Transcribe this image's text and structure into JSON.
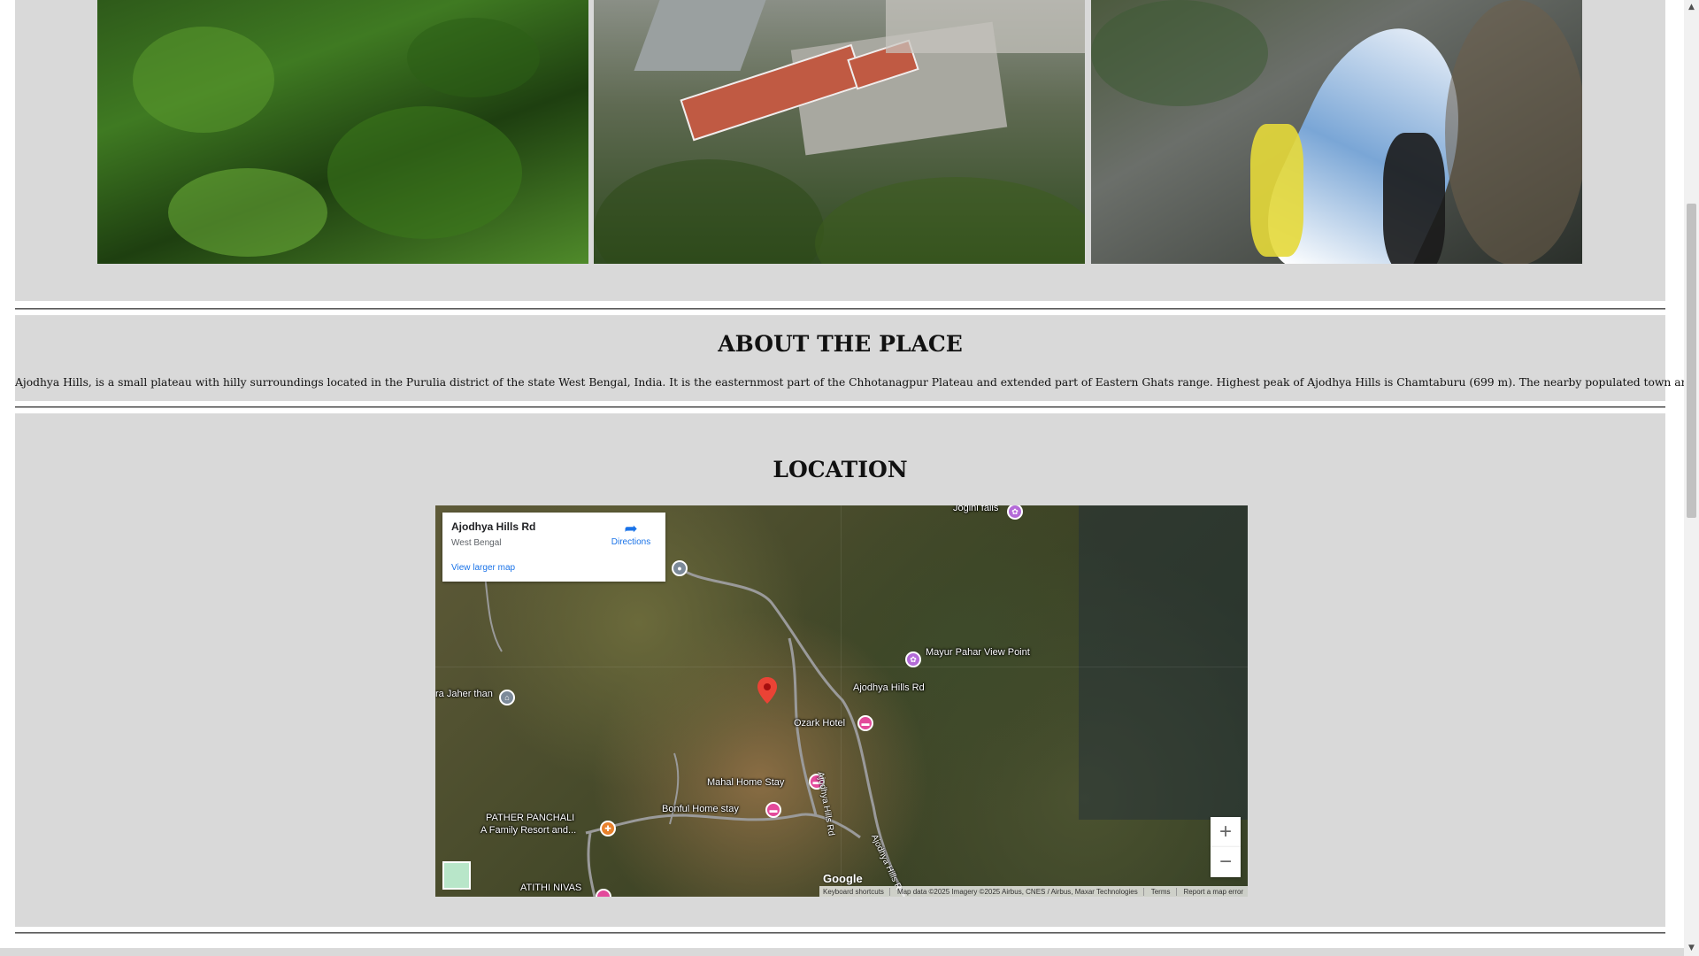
{
  "gallery": {
    "photos": [
      {
        "alt": "green-hills-photo"
      },
      {
        "alt": "dam-building-photo"
      },
      {
        "alt": "waterfall-photo"
      }
    ]
  },
  "about": {
    "heading": "ABOUT THE PLACE",
    "text": "Ajodhya Hills, is a small plateau with hilly surroundings located in the Purulia district of the state West Bengal, India. It is the easternmost part of the Chhotanagpur Plateau and extended part of Eastern Ghats range. Highest peak of Ajodhya Hills is Chamtaburu (699 m). The nearby populated town area is Bagmundi."
  },
  "location": {
    "heading": "LOCATION",
    "map": {
      "card": {
        "place": "Ajodhya Hills Rd",
        "region": "West Bengal",
        "larger_map": "View larger map",
        "directions": "Directions"
      },
      "labels": {
        "pin": "Ajodhya Hills Rd",
        "jogini_falls": "Jogini falls",
        "mayur_pahar": "Mayur Pahar View Point",
        "ozark_hotel": "Ozark Hotel",
        "mahal_home": "Mahal Home Stay",
        "bonful_home": "Bonful Home stay",
        "pather_panchali_1": "PATHER PANCHALI",
        "pather_panchali_2": "A Family Resort and...",
        "atithi_nivas": "ATITHI NIVAS",
        "jaher_than": "ra Jaher than",
        "road_1": "Ajodhya Hills Rd",
        "road_2": "Ajodhya Hills R"
      },
      "zoom_in": "+",
      "zoom_out": "−",
      "google": "Google",
      "attribution": {
        "shortcuts": "Keyboard shortcuts",
        "data": "Map data ©2025 Imagery ©2025 Airbus, CNES / Airbus, Maxar Technologies",
        "terms": "Terms",
        "report": "Report a map error"
      }
    }
  },
  "scrollbar": {
    "up": "▲",
    "down": "▼"
  }
}
